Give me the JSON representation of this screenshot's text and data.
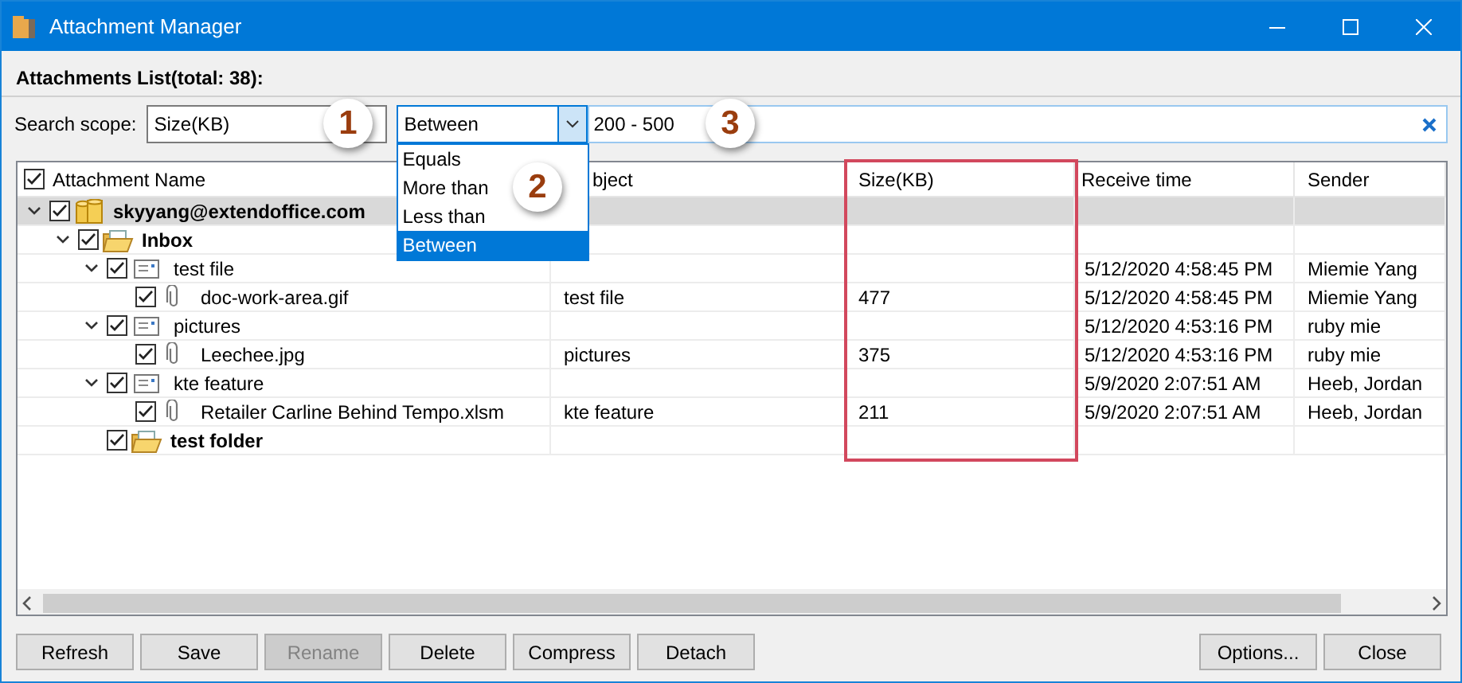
{
  "window": {
    "title": "Attachment Manager"
  },
  "heading": "Attachments List(total: 38):",
  "search": {
    "label": "Search scope:",
    "scope": "Size(KB)",
    "operator": "Between",
    "operator_open": true,
    "value": "200 - 500",
    "operator_options": [
      {
        "label": "Equals",
        "selected": false
      },
      {
        "label": "More than",
        "selected": false
      },
      {
        "label": "Less than",
        "selected": false
      },
      {
        "label": "Between",
        "selected": true
      }
    ]
  },
  "callouts": [
    "1",
    "2",
    "3"
  ],
  "table": {
    "select_all_checked": true,
    "columns": [
      {
        "label": "Attachment Name"
      },
      {
        "label": "bject"
      },
      {
        "label": "Size(KB)",
        "highlighted": true
      },
      {
        "label": "Receive time"
      },
      {
        "label": "Sender"
      }
    ],
    "rows": [
      {
        "kind": "account",
        "label": "skyyang@extendoffice.com",
        "checked": true,
        "expanded": true,
        "selected": true,
        "children": [
          {
            "kind": "folder",
            "label": "Inbox",
            "checked": true,
            "expanded": true,
            "selected": false,
            "children": [
              {
                "kind": "message",
                "label": "test file",
                "checked": true,
                "expanded": true,
                "selected": false,
                "received": "5/12/2020 4:58:45 PM",
                "sender": "Miemie Yang",
                "children": [
                  {
                    "kind": "attachment",
                    "label": "doc-work-area.gif",
                    "checked": true,
                    "selected": false,
                    "subject": "test file",
                    "size": "477",
                    "received": "5/12/2020 4:58:45 PM",
                    "sender": "Miemie Yang"
                  }
                ]
              },
              {
                "kind": "message",
                "label": "pictures",
                "checked": true,
                "expanded": true,
                "selected": false,
                "received": "5/12/2020 4:53:16 PM",
                "sender": "ruby mie",
                "children": [
                  {
                    "kind": "attachment",
                    "label": "Leechee.jpg",
                    "checked": true,
                    "selected": false,
                    "subject": "pictures",
                    "size": "375",
                    "received": "5/12/2020 4:53:16 PM",
                    "sender": "ruby mie"
                  }
                ]
              },
              {
                "kind": "message",
                "label": "kte feature",
                "checked": true,
                "expanded": true,
                "selected": false,
                "received": "5/9/2020 2:07:51 AM",
                "sender": "Heeb, Jordan",
                "children": [
                  {
                    "kind": "attachment",
                    "label": "Retailer Carline Behind Tempo.xlsm",
                    "checked": true,
                    "selected": false,
                    "subject": "kte feature",
                    "size": "211",
                    "received": "5/9/2020 2:07:51 AM",
                    "sender": "Heeb, Jordan"
                  }
                ]
              },
              {
                "kind": "folder",
                "label": "test folder",
                "checked": true,
                "selected": false
              }
            ]
          }
        ]
      }
    ]
  },
  "buttons_left": [
    {
      "label": "Refresh",
      "disabled": false
    },
    {
      "label": "Save",
      "disabled": false
    },
    {
      "label": "Rename",
      "disabled": true
    },
    {
      "label": "Delete",
      "disabled": false
    },
    {
      "label": "Compress",
      "disabled": false
    },
    {
      "label": "Detach",
      "disabled": false
    }
  ],
  "buttons_right": [
    {
      "label": "Options...",
      "disabled": false
    },
    {
      "label": "Close",
      "disabled": false
    }
  ]
}
